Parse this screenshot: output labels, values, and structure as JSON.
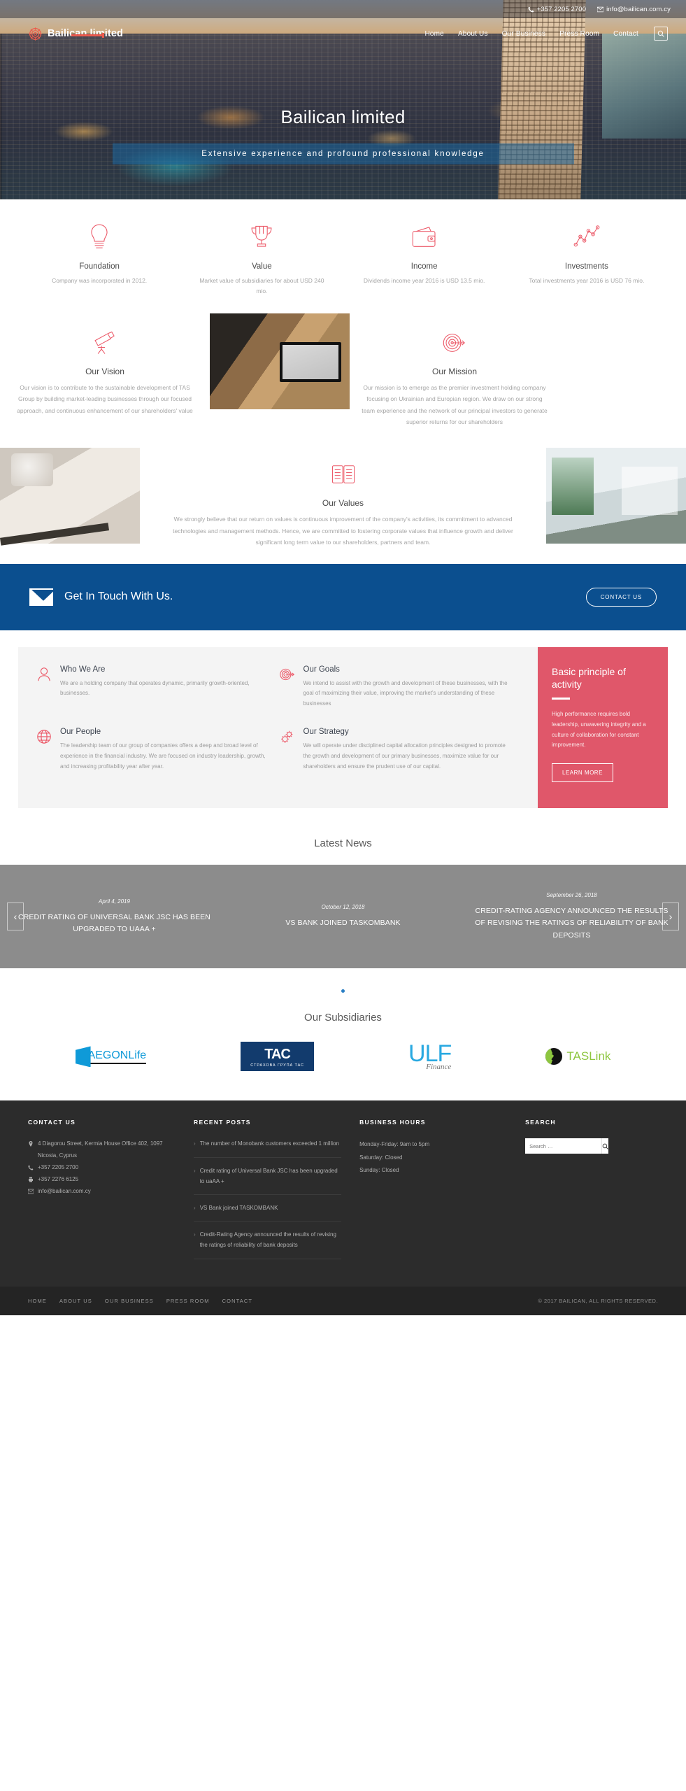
{
  "topbar": {
    "phone": "+357 2205 2700",
    "email": "info@bailican.com.cy",
    "phone_icon": "phone-icon",
    "email_icon": "envelope-icon"
  },
  "nav": {
    "logo_text": "Bailican limited",
    "links": [
      "Home",
      "About Us",
      "Our Business",
      "Press Room",
      "Contact"
    ],
    "search_icon": "search-icon"
  },
  "hero": {
    "title": "Bailican limited",
    "subtitle": "Extensive experience and profound professional knowledge"
  },
  "stats": [
    {
      "icon": "lightbulb-icon",
      "title": "Foundation",
      "desc": "Company was incorporated in 2012."
    },
    {
      "icon": "trophy-icon",
      "title": "Value",
      "desc": "Market value of subsidiaries for about USD 240 mio."
    },
    {
      "icon": "wallet-icon",
      "title": "Income",
      "desc": "Dividends income year 2016 is USD 13.5 mio."
    },
    {
      "icon": "chart-line-icon",
      "title": "Investments",
      "desc": "Total investments year 2016 is USD 76 mio."
    }
  ],
  "vision": {
    "icon": "telescope-icon",
    "title": "Our Vision",
    "text": "Our vision is to contribute to the sustainable development of TAS Group by building market-leading businesses through our focused approach, and continuous enhancement of our shareholders' value"
  },
  "mission": {
    "icon": "target-icon",
    "title": "Our Mission",
    "text": "Our mission is to emerge as the premier investment holding company focusing on Ukrainian and Europian region. We draw on our strong team experience and the network of our principal investors to generate superior returns for our shareholders"
  },
  "values": {
    "icon": "book-icon",
    "title": "Our Values",
    "text": "We strongly believe that our return on values is continuous improvement of the company's activities, its commitment to advanced technologies and management methods. Hence, we are committed to fostering corporate values that influence growth and deliver significant long term value to our shareholders, partners and team."
  },
  "get_in_touch": {
    "icon": "envelope-icon",
    "heading": "Get In Touch With Us.",
    "button": "CONTACT US",
    "bg_color": "#0b4f8f"
  },
  "principles": {
    "items": [
      {
        "icon": "person-icon",
        "title": "Who We Are",
        "text": "We are a holding company that operates dynamic, primarily growth-oriented, businesses."
      },
      {
        "icon": "target-icon",
        "title": "Our Goals",
        "text": "We intend to assist with the growth and development of these businesses, with the goal of maximizing their value, improving the market's understanding of these businesses"
      },
      {
        "icon": "globe-icon",
        "title": "Our People",
        "text": "The leadership team of our group of companies offers a deep and broad level of experience in the financial industry. We are focused on industry leadership, growth, and increasing profitability year after year."
      },
      {
        "icon": "gears-icon",
        "title": "Our Strategy",
        "text": "We will operate under disciplined capital allocation principles designed to promote the growth and development of our primary businesses, maximize value for our shareholders and ensure the prudent use of our capital."
      }
    ],
    "panel": {
      "title": "Basic principle of activity",
      "text": "High performance requires bold leadership, unwavering integrity and a culture of collaboration for constant improvement.",
      "button": "LEARN MORE",
      "bg_color": "#e0576a"
    }
  },
  "news": {
    "heading": "Latest News",
    "prev_icon": "chevron-left-icon",
    "next_icon": "chevron-right-icon",
    "items": [
      {
        "date": "April 4, 2019",
        "headline": "CREDIT RATING OF UNIVERSAL BANK JSC HAS BEEN UPGRADED TO UAAA +"
      },
      {
        "date": "October 12, 2018",
        "headline": "VS BANK JOINED TASKOMBANK"
      },
      {
        "date": "September 26, 2018",
        "headline": "CREDIT-RATING AGENCY ANNOUNCED THE RESULTS OF REVISING THE RATINGS OF RELIABILITY OF BANK DEPOSITS"
      }
    ]
  },
  "subsidiaries": {
    "heading": "Our Subsidiaries",
    "logos": [
      {
        "name": "aegon-life-logo",
        "main": "AEGON",
        "accent": "Life"
      },
      {
        "name": "tac-logo",
        "main": "TAC",
        "sub": "СТРАХОВА ГРУПА ТАС"
      },
      {
        "name": "ulf-finance-logo",
        "main": "ULF",
        "sub": "Finance"
      },
      {
        "name": "taslink-logo",
        "main": "TAS",
        "accent": "Link"
      }
    ]
  },
  "footer": {
    "contact": {
      "heading": "CONTACT US",
      "address": "4 Diagorou Street, Kermia House Office 402, 1097 Nicosia, Cyprus",
      "phone": "+357 2205 2700",
      "fax": "+357 2276 6125",
      "email": "info@bailican.com.cy",
      "address_icon": "map-pin-icon",
      "phone_icon": "phone-icon",
      "fax_icon": "printer-icon",
      "email_icon": "envelope-icon"
    },
    "recent_posts": {
      "heading": "RECENT POSTS",
      "items": [
        "The number of Monobank customers exceeded 1 million",
        "Credit rating of Universal Bank JSC has been upgraded to uaAA +",
        "VS Bank joined TASKOMBANK",
        "Credit-Rating Agency announced the results of revising the ratings of reliability of bank deposits"
      ]
    },
    "business_hours": {
      "heading": "BUSINESS HOURS",
      "lines": [
        "Monday-Friday: 9am to 5pm",
        "Saturday: Closed",
        "Sunday: Closed"
      ]
    },
    "search": {
      "heading": "SEARCH",
      "placeholder": "Search …",
      "value": "",
      "icon": "search-icon"
    },
    "bottom_nav": [
      "HOME",
      "ABOUT US",
      "OUR BUSINESS",
      "PRESS ROOM",
      "CONTACT"
    ],
    "copyright": "© 2017 BAILICAN, ALL RIGHTS RESERVED."
  }
}
